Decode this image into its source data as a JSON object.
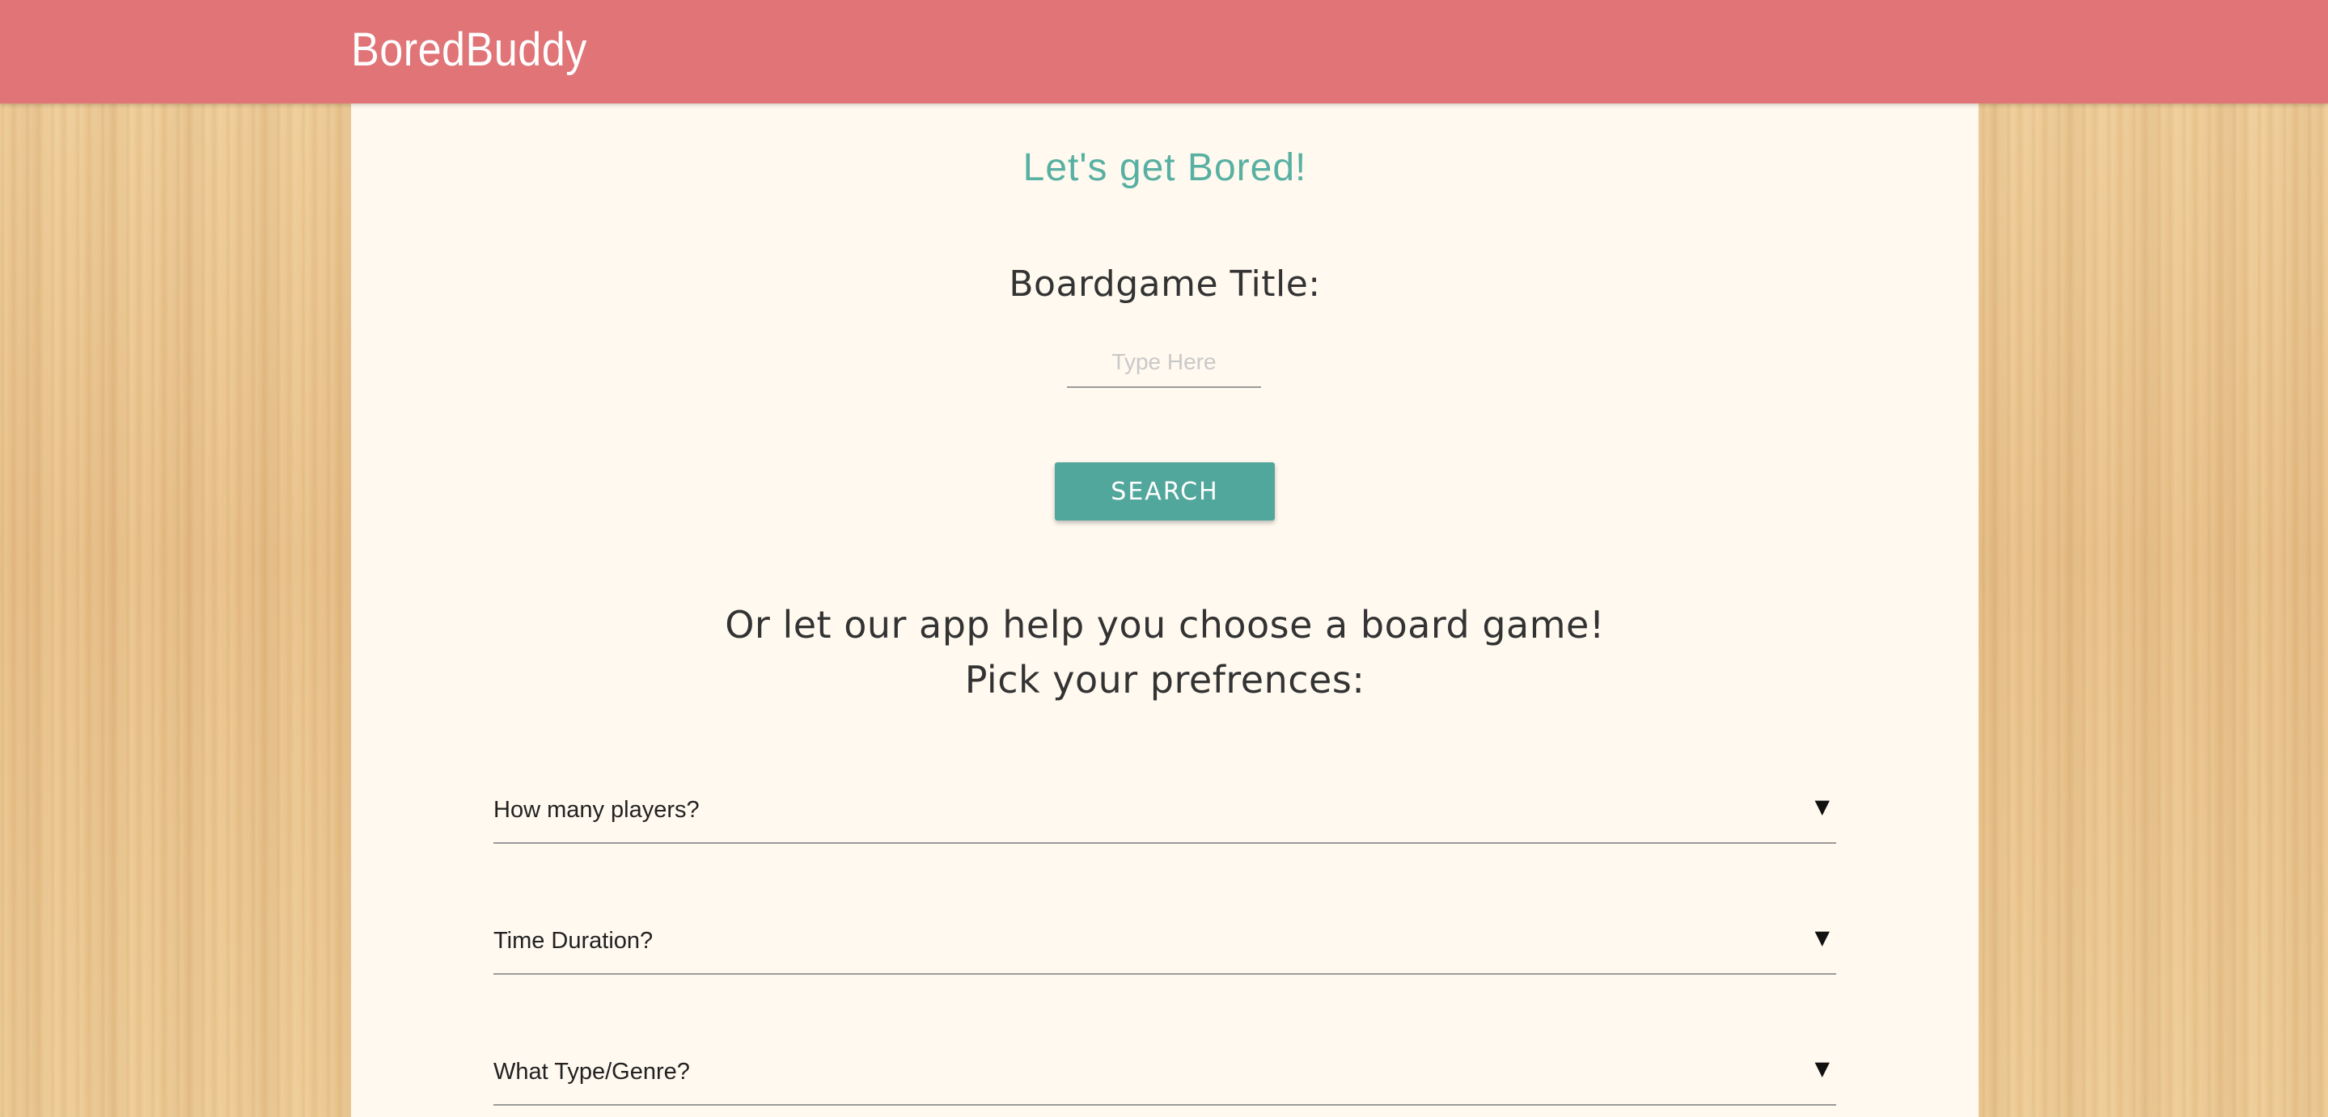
{
  "header": {
    "brand": "BoredBuddy"
  },
  "main": {
    "tagline": "Let's get Bored!",
    "title_label": "Boardgame Title:",
    "title_input": {
      "value": "",
      "placeholder": "Type Here"
    },
    "search_label": "SEARCH",
    "help_line_1": "Or let our app help you choose a board game!",
    "help_line_2": "Pick your prefrences:",
    "preferences": [
      {
        "label": "How many players?",
        "icon": "triangle-down-icon"
      },
      {
        "label": "Time Duration?",
        "icon": "triangle-down-icon"
      },
      {
        "label": "What Type/Genre?",
        "icon": "triangle-down-icon"
      }
    ],
    "caret_glyph": "▼"
  },
  "colors": {
    "navbar": "#e07477",
    "panel": "#fff9ef",
    "accent": "#58b0a2",
    "button": "#52a79c",
    "wood": "#eac48e"
  }
}
